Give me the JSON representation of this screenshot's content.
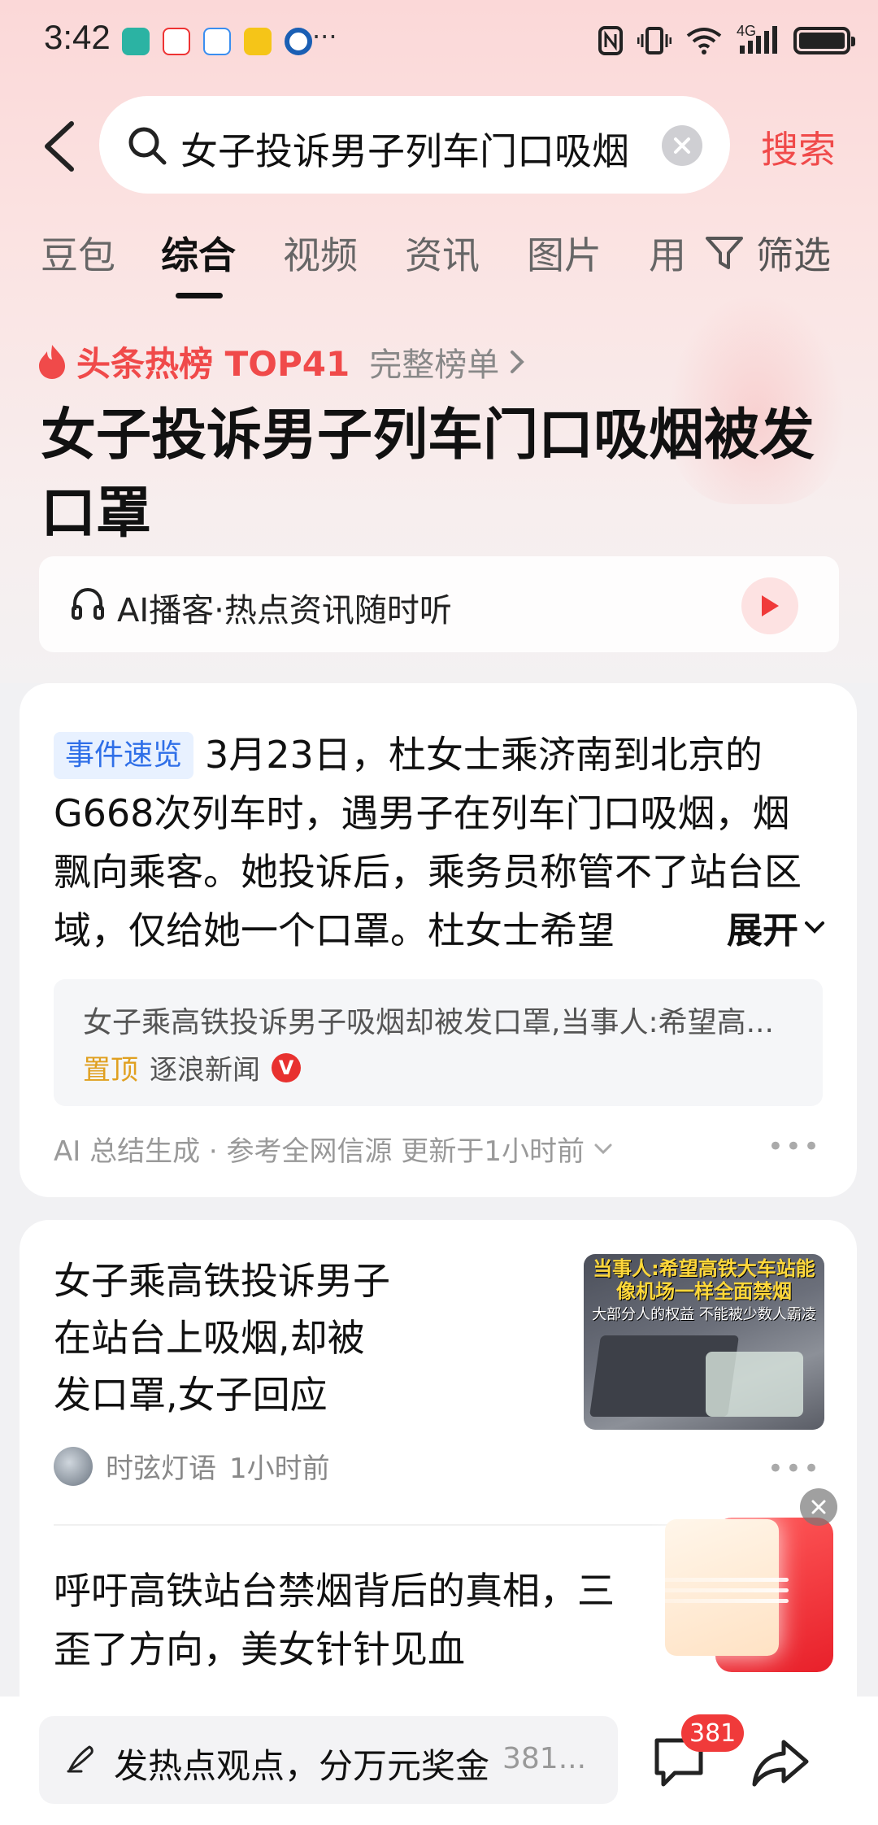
{
  "status_bar": {
    "time": "3:42",
    "more": "···",
    "network": "4G"
  },
  "search": {
    "query": "女子投诉男子列车门口吸烟",
    "submit_label": "搜索"
  },
  "tabs": [
    {
      "label": "豆包",
      "active": false
    },
    {
      "label": "综合",
      "active": true
    },
    {
      "label": "视频",
      "active": false
    },
    {
      "label": "资讯",
      "active": false
    },
    {
      "label": "图片",
      "active": false
    },
    {
      "label": "用",
      "active": false
    }
  ],
  "filter_label": "筛选",
  "hot": {
    "label": "头条热榜 TOP41",
    "full_list": "完整榜单"
  },
  "main_title": "女子投诉男子列车门口吸烟被发口罩",
  "podcast": {
    "text": "AI播客·热点资讯随时听"
  },
  "event": {
    "tag": "事件速览",
    "summary": "3月23日，杜女士乘济南到北京的G668次列车时，遇男子在列车门口吸烟，烟飘向乘客。她投诉后，乘务员称管不了站台区域，仅给她一个口罩。杜女士希望",
    "expand_label": "展开",
    "source_title": "女子乘高铁投诉男子吸烟却被发口罩,当事人:希望高...",
    "pin_label": "置顶",
    "source_name": "逐浪新闻",
    "verified_badge": "V",
    "ai_footer": "AI 总结生成 · 参考全网信源 更新于1小时前"
  },
  "news": [
    {
      "title": "女子乘高铁投诉男子在站台上吸烟,却被发口罩,女子回应",
      "thumb_caption_1": "当事人:希望高铁大车站能像机场一样全面禁烟",
      "thumb_caption_2": "大部分人的权益 不能被少数人霸凌",
      "author": "时弦灯语",
      "time": "1小时前"
    },
    {
      "title": "呼吁高铁站台禁烟背后的真相，三歪了方向，美女针针见血"
    }
  ],
  "promo": {
    "symbol": "¥"
  },
  "bottom": {
    "comment_placeholder": "发热点观点，分万元奖金",
    "comment_count_inline": "381...",
    "comment_badge": "381"
  },
  "colors": {
    "accent_red": "#f04a4a",
    "tag_blue": "#2f6fe8",
    "pin_orange": "#e0a020"
  }
}
